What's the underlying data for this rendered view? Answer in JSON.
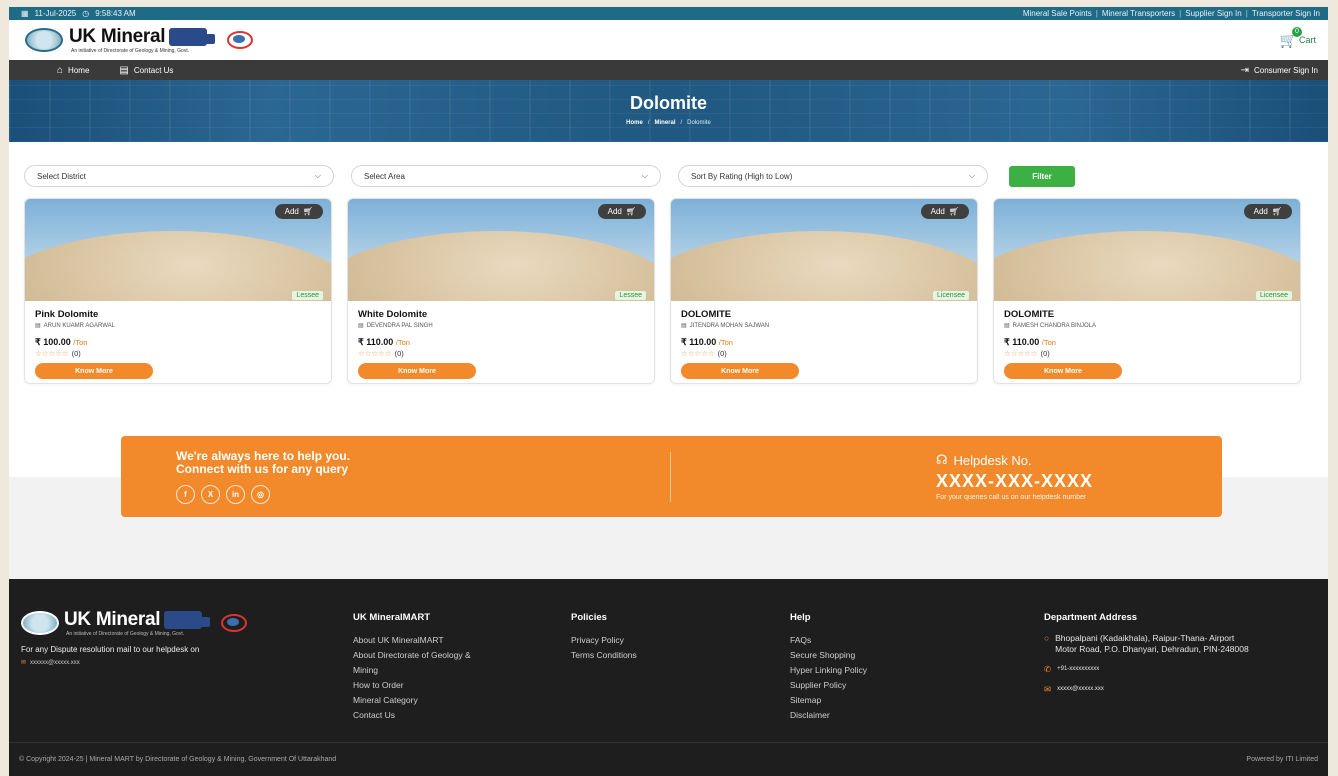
{
  "topbar": {
    "date": "11-Jul-2025",
    "time": "9:58:43 AM",
    "links": [
      "Mineral Sale Points",
      "Mineral Transporters",
      "Supplier Sign In",
      "Transporter Sign In"
    ]
  },
  "header": {
    "brand": "UK Mineral",
    "brand_badge": "MART",
    "tagline": "An initiative of Directorate of Geology & Mining, Govt.",
    "cart_label": "Cart",
    "cart_count": "0"
  },
  "nav": {
    "home": "Home",
    "contact": "Contact Us",
    "consumer_signin": "Consumer Sign In"
  },
  "banner": {
    "title": "Dolomite",
    "crumbs": [
      "Home",
      "Mineral",
      "Dolomite"
    ]
  },
  "filters": {
    "district": "Select District",
    "area": "Select Area",
    "sort": "Sort By Rating (High to Low)",
    "button": "Filter"
  },
  "cards": [
    {
      "add": "Add",
      "badge": "Lessee",
      "title": "Pink Dolomite",
      "owner": "ARUN KUAMR AGARWAL",
      "price": "₹ 100.00",
      "unit": "/Ton",
      "stars": "☆☆☆☆☆",
      "rating_count": "(0)",
      "know": "Know More"
    },
    {
      "add": "Add",
      "badge": "Lessee",
      "title": "White Dolomite",
      "owner": "DEVENDRA PAL SINGH",
      "price": "₹ 110.00",
      "unit": "/Ton",
      "stars": "☆☆☆☆☆",
      "rating_count": "(0)",
      "know": "Know More"
    },
    {
      "add": "Add",
      "badge": "Licensee",
      "title": "DOLOMITE",
      "owner": "JITENDRA MOHAN SAJWAN",
      "price": "₹ 110.00",
      "unit": "/Ton",
      "stars": "☆☆☆☆☆",
      "rating_count": "(0)",
      "know": "Know More"
    },
    {
      "add": "Add",
      "badge": "Licensee",
      "title": "DOLOMITE",
      "owner": "RAMESH CHANDRA BINJOLA",
      "price": "₹ 110.00",
      "unit": "/Ton",
      "stars": "☆☆☆☆☆",
      "rating_count": "(0)",
      "know": "Know More"
    }
  ],
  "help": {
    "line1": "We're always here to help you.",
    "line2": "Connect with us for any query",
    "social": [
      "f",
      "X",
      "in",
      "◎"
    ],
    "helpdesk_title": "Helpdesk No.",
    "number": "XXXX-XXX-XXXX",
    "sub": "For your queries call us on our helpdesk number"
  },
  "footer": {
    "dispute": "For any Dispute resolution mail to our helpdesk on",
    "dispute_mail": "xxxxxx@xxxxx.xxx",
    "col1": {
      "title": "UK MineralMART",
      "links": [
        "About UK MineralMART",
        "About Directorate of Geology &",
        "Mining",
        "How to Order",
        "Mineral Category",
        "Contact Us"
      ]
    },
    "col2": {
      "title": "Policies",
      "links": [
        "Privacy Policy",
        "Terms Conditions"
      ]
    },
    "col3": {
      "title": "Help",
      "links": [
        "FAQs",
        "Secure Shopping",
        "Hyper Linking Policy",
        "Supplier Policy",
        "Sitemap",
        "Disclaimer"
      ]
    },
    "col4": {
      "title": "Department Address",
      "address_l1": "Bhopalpani (Kadaikhala), Raipur-Thana- Airport",
      "address_l2": "Motor Road, P.O. Dhanyari, Dehradun, PIN-248008",
      "phone": "+91-xxxxxxxxxx",
      "email": "xxxxx@xxxxx.xxx"
    },
    "copyright": "© Copyright 2024-25 | Mineral MART by Directorate of Geology & Mining, Government Of Uttarakhand",
    "powered": "Powered by ITI Limited"
  }
}
